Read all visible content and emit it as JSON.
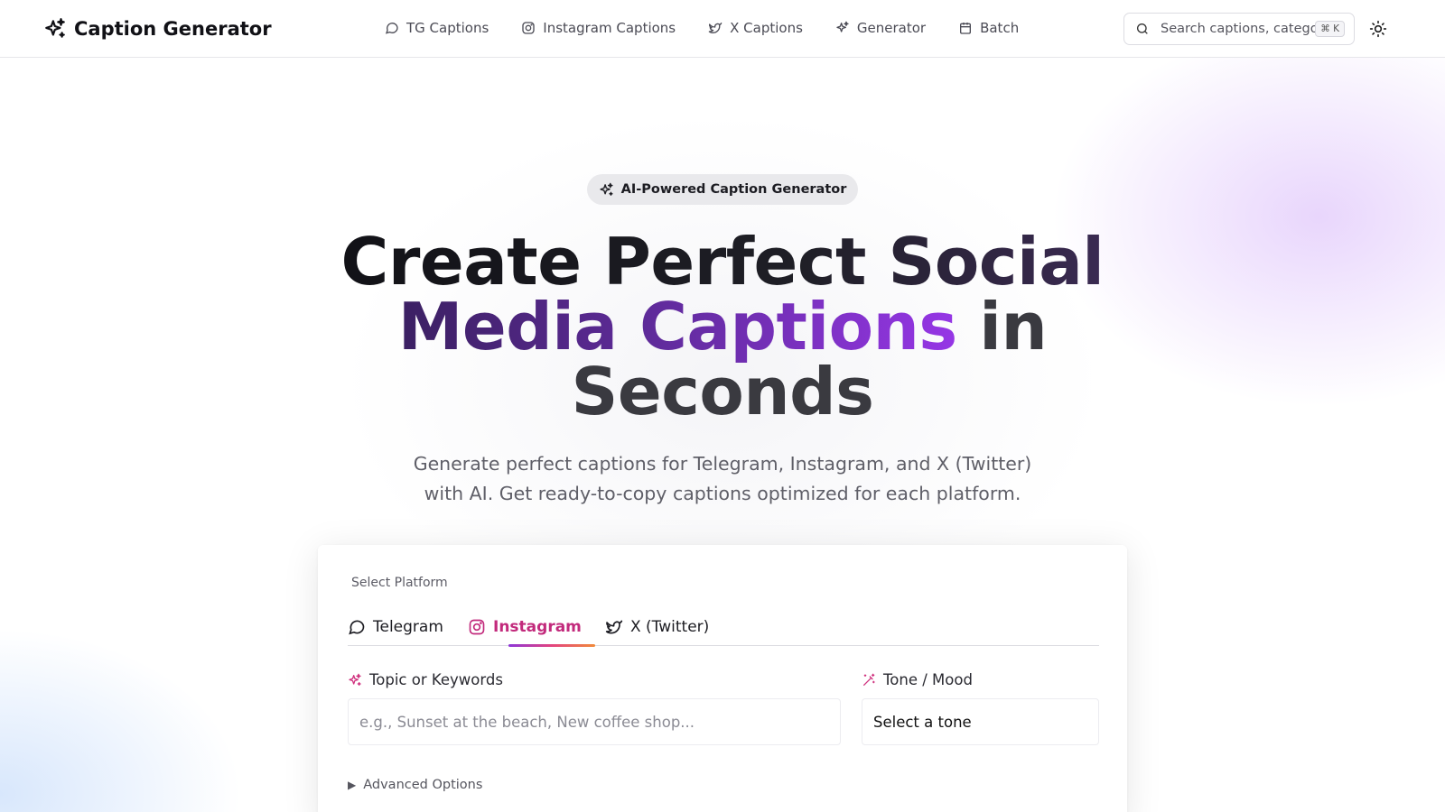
{
  "header": {
    "brand": "Caption Generator",
    "nav": [
      {
        "label": "TG Captions",
        "icon": "message-circle-icon"
      },
      {
        "label": "Instagram Captions",
        "icon": "instagram-icon"
      },
      {
        "label": "X Captions",
        "icon": "twitter-bird-icon"
      },
      {
        "label": "Generator",
        "icon": "sparkles-icon"
      },
      {
        "label": "Batch",
        "icon": "calendar-icon"
      }
    ],
    "search": {
      "placeholder": "Search captions, categories...",
      "shortcut": "⌘ K"
    }
  },
  "hero": {
    "badge": "AI-Powered Caption Generator",
    "title_line1": "Create Perfect Social",
    "title_line2_highlight": "Media Captions",
    "title_line2_rest": " in",
    "title_line3": "Seconds",
    "subtitle_line1": "Generate perfect captions for Telegram, Instagram, and X (Twitter)",
    "subtitle_line2": "with AI. Get ready-to-copy captions optimized for each platform."
  },
  "form": {
    "platform_label": "Select Platform",
    "tabs": [
      {
        "label": "Telegram",
        "active": false
      },
      {
        "label": "Instagram",
        "active": true
      },
      {
        "label": "X (Twitter)",
        "active": false
      }
    ],
    "topic_label": "Topic or Keywords",
    "topic_placeholder": "e.g., Sunset at the beach, New coffee shop...",
    "tone_label": "Tone / Mood",
    "tone_value": "Select a tone",
    "advanced_label": "Advanced Options"
  },
  "colors": {
    "accent_instagram": "#c22a7c",
    "gradient_purple": "#9636e6"
  }
}
